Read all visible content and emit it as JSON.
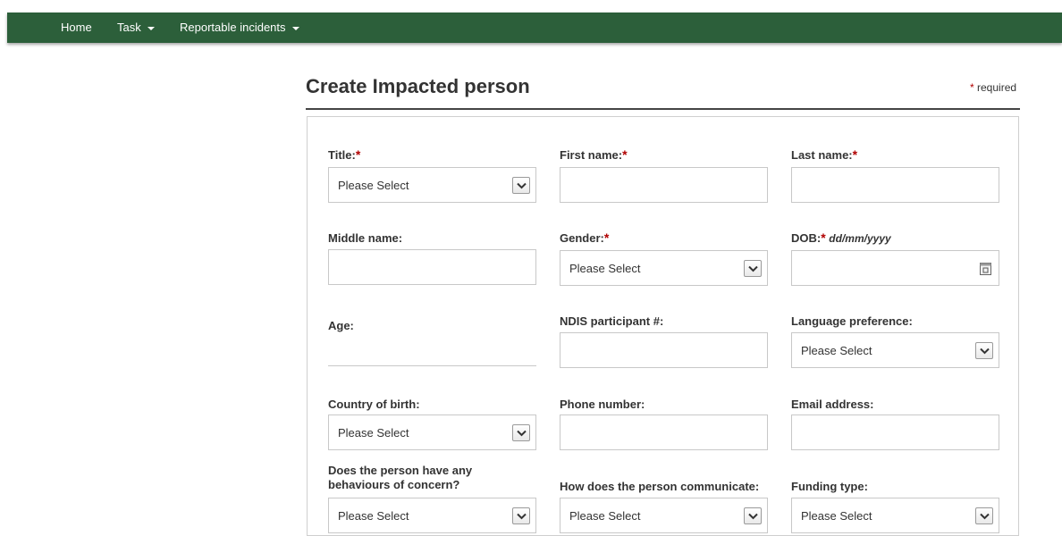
{
  "nav": {
    "home": "Home",
    "task": "Task",
    "incidents": "Reportable incidents"
  },
  "page": {
    "title": "Create Impacted person",
    "required_star": "*",
    "required_text": "required"
  },
  "form": {
    "star": "*",
    "select_placeholder": "Please Select",
    "title_label": "Title:",
    "first_name_label": "First name:",
    "last_name_label": "Last name:",
    "middle_name_label": "Middle name:",
    "gender_label": "Gender:",
    "dob_label": "DOB:",
    "dob_hint": "dd/mm/yyyy",
    "age_label": "Age:",
    "ndis_label": "NDIS participant #:",
    "language_label": "Language preference:",
    "country_label": "Country of birth:",
    "phone_label": "Phone number:",
    "email_label": "Email address:",
    "behaviours_label": "Does the person have any behaviours of concern?",
    "communicate_label": "How does the person communicate:",
    "funding_label": "Funding type:"
  },
  "colors": {
    "navbar": "#2c5f3a",
    "required_star": "#b10000"
  },
  "icons": [
    "chevron-down-icon",
    "calendar-icon",
    "caret-down-icon"
  ]
}
